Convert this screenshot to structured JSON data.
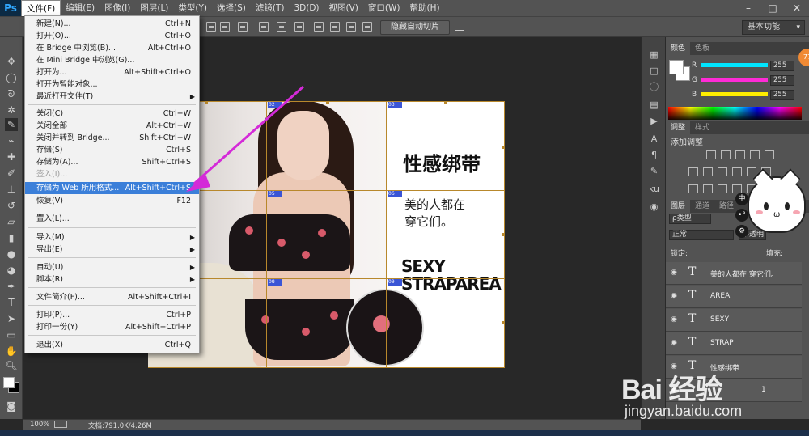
{
  "app": {
    "logo": "Ps",
    "colors": {
      "ui_dark": "#535353",
      "canvas_bg": "#282828",
      "menu_highlight": "#3b7fd9",
      "slice_line": "#b8882c",
      "slice_tag": "#3a55d6",
      "arrow": "#d42ad8"
    }
  },
  "menubar": {
    "items": [
      "文件(F)",
      "编辑(E)",
      "图像(I)",
      "图层(L)",
      "类型(Y)",
      "选择(S)",
      "滤镜(T)",
      "3D(D)",
      "视图(V)",
      "窗口(W)",
      "帮助(H)"
    ],
    "window_controls": [
      "–",
      "□",
      "✕"
    ]
  },
  "options_bar": {
    "hide_slices_button": "隐藏自动切片",
    "workspace_select": "基本功能"
  },
  "file_menu": {
    "items": [
      {
        "label": "新建(N)...",
        "shortcut": "Ctrl+N"
      },
      {
        "label": "打开(O)...",
        "shortcut": "Ctrl+O"
      },
      {
        "label": "在 Bridge 中浏览(B)...",
        "shortcut": "Alt+Ctrl+O"
      },
      {
        "label": "在 Mini Bridge 中浏览(G)...",
        "shortcut": ""
      },
      {
        "label": "打开为...",
        "shortcut": "Alt+Shift+Ctrl+O"
      },
      {
        "label": "打开为智能对象...",
        "shortcut": ""
      },
      {
        "label": "最近打开文件(T)",
        "shortcut": ""
      },
      {
        "label": "关闭(C)",
        "shortcut": "Ctrl+W"
      },
      {
        "label": "关闭全部",
        "shortcut": "Alt+Ctrl+W"
      },
      {
        "label": "关闭并转到 Bridge...",
        "shortcut": "Shift+Ctrl+W"
      },
      {
        "label": "存储(S)",
        "shortcut": "Ctrl+S"
      },
      {
        "label": "存储为(A)...",
        "shortcut": "Shift+Ctrl+S"
      },
      {
        "label": "签入(I)...",
        "shortcut": ""
      },
      {
        "label": "存储为 Web 所用格式...",
        "shortcut": "Alt+Shift+Ctrl+S"
      },
      {
        "label": "恢复(V)",
        "shortcut": "F12"
      },
      {
        "label": "置入(L)...",
        "shortcut": ""
      },
      {
        "label": "导入(M)",
        "shortcut": ""
      },
      {
        "label": "导出(E)",
        "shortcut": ""
      },
      {
        "label": "自动(U)",
        "shortcut": ""
      },
      {
        "label": "脚本(R)",
        "shortcut": ""
      },
      {
        "label": "文件简介(F)...",
        "shortcut": "Alt+Shift+Ctrl+I"
      },
      {
        "label": "打印(P)...",
        "shortcut": "Ctrl+P"
      },
      {
        "label": "打印一份(Y)",
        "shortcut": "Alt+Shift+Ctrl+P"
      },
      {
        "label": "退出(X)",
        "shortcut": "Ctrl+Q"
      }
    ]
  },
  "document": {
    "headline": "性感绑带",
    "subline_1": "美的人都在",
    "subline_2": "穿它们。",
    "english_1": "SEXY",
    "english_2": "STRAPAREA",
    "slice_tags": [
      "02",
      "03",
      "05",
      "06",
      "08",
      "09"
    ]
  },
  "color_panel": {
    "tabs": [
      "颜色",
      "色板"
    ],
    "channels": [
      {
        "label": "R",
        "value": "255",
        "color": "#00e5ff"
      },
      {
        "label": "G",
        "value": "255",
        "color": "#ff2bd6"
      },
      {
        "label": "B",
        "value": "255",
        "color": "#ffee00"
      }
    ]
  },
  "adjustments_panel": {
    "tabs": [
      "调整",
      "样式"
    ],
    "title": "添加调整"
  },
  "layers_panel": {
    "tabs": [
      "图层",
      "通道",
      "路径"
    ],
    "kind_filter": "ρ类型",
    "blend_mode": "正常",
    "opacity_label": "不透明",
    "lock_label": "锁定:",
    "fill_label": "填充:",
    "layers": [
      "美的人都在 穿它们。",
      "AREA",
      "SEXY",
      "STRAP",
      "性感绑带"
    ],
    "partial_layer_value": "1"
  },
  "side_chips": [
    "中",
    "•°",
    "⚙"
  ],
  "orange_badge": "77",
  "status_bar": {
    "zoom": "100%",
    "doc_info": "文档:791.0K/4.26M"
  },
  "watermark": {
    "brand": "Bai 经验",
    "url": "jingyan.baidu.com"
  }
}
